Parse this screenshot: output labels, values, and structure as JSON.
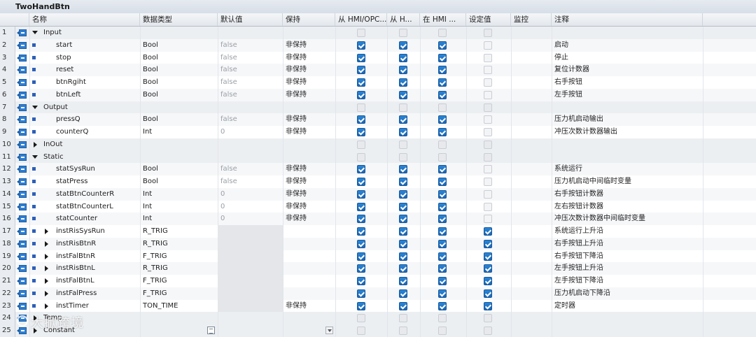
{
  "block_title": "TwoHandBtn",
  "columns": {
    "name": "名称",
    "datatype": "数据类型",
    "default": "默认值",
    "retain": "保持",
    "hmi_opc": "从 HMI/OPC...",
    "hmi_h": "从 H...",
    "in_hmi": "在 HMI ...",
    "setpoint": "设定值",
    "monitor": "监控",
    "comment": "注释"
  },
  "rows": [
    {
      "num": "1",
      "kind": "section",
      "expand": "open",
      "name": "Input",
      "datatype": "",
      "default": "",
      "retain": "",
      "c1": "dis",
      "c2": "dis",
      "c3": "dis",
      "c4": "dis",
      "comment": ""
    },
    {
      "num": "2",
      "kind": "member",
      "name": "start",
      "datatype": "Bool",
      "default": "false",
      "retain": "非保持",
      "c1": "on",
      "c2": "on",
      "c3": "on",
      "c4": "off",
      "comment": "启动"
    },
    {
      "num": "3",
      "kind": "member",
      "name": "stop",
      "datatype": "Bool",
      "default": "false",
      "retain": "非保持",
      "c1": "on",
      "c2": "on",
      "c3": "on",
      "c4": "off",
      "comment": "停止"
    },
    {
      "num": "4",
      "kind": "member",
      "name": "reset",
      "datatype": "Bool",
      "default": "false",
      "retain": "非保持",
      "c1": "on",
      "c2": "on",
      "c3": "on",
      "c4": "off",
      "comment": "复位计数器"
    },
    {
      "num": "5",
      "kind": "member",
      "name": "btnRgiht",
      "datatype": "Bool",
      "default": "false",
      "retain": "非保持",
      "c1": "on",
      "c2": "on",
      "c3": "on",
      "c4": "off",
      "comment": "右手按钮"
    },
    {
      "num": "6",
      "kind": "member",
      "name": "btnLeft",
      "datatype": "Bool",
      "default": "false",
      "retain": "非保持",
      "c1": "on",
      "c2": "on",
      "c3": "on",
      "c4": "off",
      "comment": "左手按钮"
    },
    {
      "num": "7",
      "kind": "section",
      "expand": "open",
      "name": "Output",
      "datatype": "",
      "default": "",
      "retain": "",
      "c1": "dis",
      "c2": "dis",
      "c3": "dis",
      "c4": "dis",
      "comment": ""
    },
    {
      "num": "8",
      "kind": "member",
      "name": "pressQ",
      "datatype": "Bool",
      "default": "false",
      "retain": "非保持",
      "c1": "on",
      "c2": "on",
      "c3": "on",
      "c4": "off",
      "comment": "压力机启动输出"
    },
    {
      "num": "9",
      "kind": "member",
      "name": "counterQ",
      "datatype": "Int",
      "default": "0",
      "retain": "非保持",
      "c1": "on",
      "c2": "on",
      "c3": "on",
      "c4": "off",
      "comment": "冲压次数计数器输出"
    },
    {
      "num": "10",
      "kind": "section",
      "expand": "closed",
      "name": "InOut",
      "datatype": "",
      "default": "",
      "retain": "",
      "c1": "dis",
      "c2": "dis",
      "c3": "dis",
      "c4": "dis",
      "comment": ""
    },
    {
      "num": "11",
      "kind": "section",
      "expand": "open",
      "name": "Static",
      "datatype": "",
      "default": "",
      "retain": "",
      "c1": "dis",
      "c2": "dis",
      "c3": "dis",
      "c4": "dis",
      "comment": ""
    },
    {
      "num": "12",
      "kind": "member",
      "name": "statSysRun",
      "datatype": "Bool",
      "default": "false",
      "retain": "非保持",
      "c1": "on",
      "c2": "on",
      "c3": "on",
      "c4": "off",
      "comment": "系统运行"
    },
    {
      "num": "13",
      "kind": "member",
      "name": "statPress",
      "datatype": "Bool",
      "default": "false",
      "retain": "非保持",
      "c1": "on",
      "c2": "on",
      "c3": "on",
      "c4": "off",
      "comment": "压力机启动中间临时变量"
    },
    {
      "num": "14",
      "kind": "member",
      "name": "statBtnCounterR",
      "datatype": "Int",
      "default": "0",
      "retain": "非保持",
      "c1": "on",
      "c2": "on",
      "c3": "on",
      "c4": "off",
      "comment": "右手按钮计数器"
    },
    {
      "num": "15",
      "kind": "member",
      "name": "statBtnCounterL",
      "datatype": "Int",
      "default": "0",
      "retain": "非保持",
      "c1": "on",
      "c2": "on",
      "c3": "on",
      "c4": "off",
      "comment": "左右按钮计数器"
    },
    {
      "num": "16",
      "kind": "member",
      "name": "statCounter",
      "datatype": "Int",
      "default": "0",
      "retain": "非保持",
      "c1": "on",
      "c2": "on",
      "c3": "on",
      "c4": "off",
      "comment": "冲压次数计数器中间临时变量"
    },
    {
      "num": "17",
      "kind": "instance",
      "name": "instRisSysRun",
      "datatype": "R_TRIG",
      "default": "",
      "retain": "",
      "c1": "on",
      "c2": "on",
      "c3": "on",
      "c4": "on",
      "comment": "系统运行上升沿"
    },
    {
      "num": "18",
      "kind": "instance",
      "name": "instRisBtnR",
      "datatype": "R_TRIG",
      "default": "",
      "retain": "",
      "c1": "on",
      "c2": "on",
      "c3": "on",
      "c4": "on",
      "comment": "右手按钮上升沿"
    },
    {
      "num": "19",
      "kind": "instance",
      "name": "instFalBtnR",
      "datatype": "F_TRIG",
      "default": "",
      "retain": "",
      "c1": "on",
      "c2": "on",
      "c3": "on",
      "c4": "on",
      "comment": "右手按钮下降沿"
    },
    {
      "num": "20",
      "kind": "instance",
      "name": "instRisBtnL",
      "datatype": "R_TRIG",
      "default": "",
      "retain": "",
      "c1": "on",
      "c2": "on",
      "c3": "on",
      "c4": "on",
      "comment": "左手按钮上升沿"
    },
    {
      "num": "21",
      "kind": "instance",
      "name": "instFalBtnL",
      "datatype": "F_TRIG",
      "default": "",
      "retain": "",
      "c1": "on",
      "c2": "on",
      "c3": "on",
      "c4": "on",
      "comment": "左手按钮下降沿"
    },
    {
      "num": "22",
      "kind": "instance",
      "name": "instFalPress",
      "datatype": "F_TRIG",
      "default": "",
      "retain": "",
      "c1": "on",
      "c2": "on",
      "c3": "on",
      "c4": "on",
      "comment": "压力机启动下降沿"
    },
    {
      "num": "23",
      "kind": "instance",
      "name": "instTimer",
      "datatype": "TON_TIME",
      "default": "",
      "retain": "非保持",
      "c1": "on",
      "c2": "on",
      "c3": "on",
      "c4": "on",
      "comment": "定时器"
    },
    {
      "num": "24",
      "kind": "section",
      "expand": "closed",
      "name": "Temp",
      "datatype": "",
      "default": "",
      "retain": "",
      "c1": "dis",
      "c2": "dis",
      "c3": "dis",
      "c4": "dis",
      "comment": ""
    },
    {
      "num": "25",
      "kind": "section",
      "expand": "closed",
      "name": "Constant",
      "datatype": "",
      "default": "",
      "retain": "",
      "c1": "dis",
      "c2": "dis",
      "c3": "dis",
      "c4": "dis",
      "comment": "",
      "editing": true
    }
  ],
  "watermark": "大掀跨境"
}
